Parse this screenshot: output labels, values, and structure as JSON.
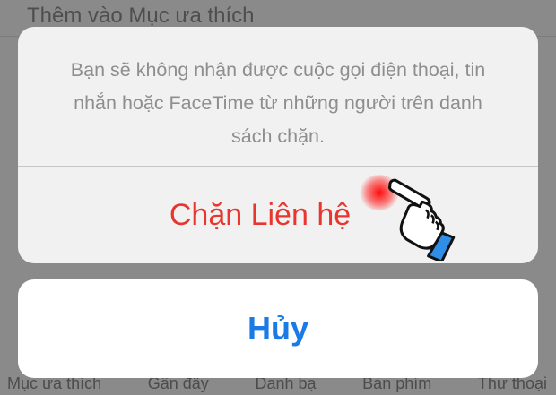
{
  "background": {
    "top_label": "Thêm vào Mục ưa thích",
    "tabs": [
      "Mục ưa thích",
      "Gần đây",
      "Danh bạ",
      "Bàn phím",
      "Thư thoại"
    ]
  },
  "action_sheet": {
    "message": "Bạn sẽ không nhận được cuộc gọi điện thoại, tin nhắn hoặc FaceTime từ những người trên danh sách chặn.",
    "block_contact_label": "Chặn Liên hệ",
    "cancel_label": "Hủy"
  },
  "colors": {
    "destructive": "#e8362f",
    "accent": "#1b7be6"
  },
  "icons": [
    "pointing-hand-icon"
  ]
}
